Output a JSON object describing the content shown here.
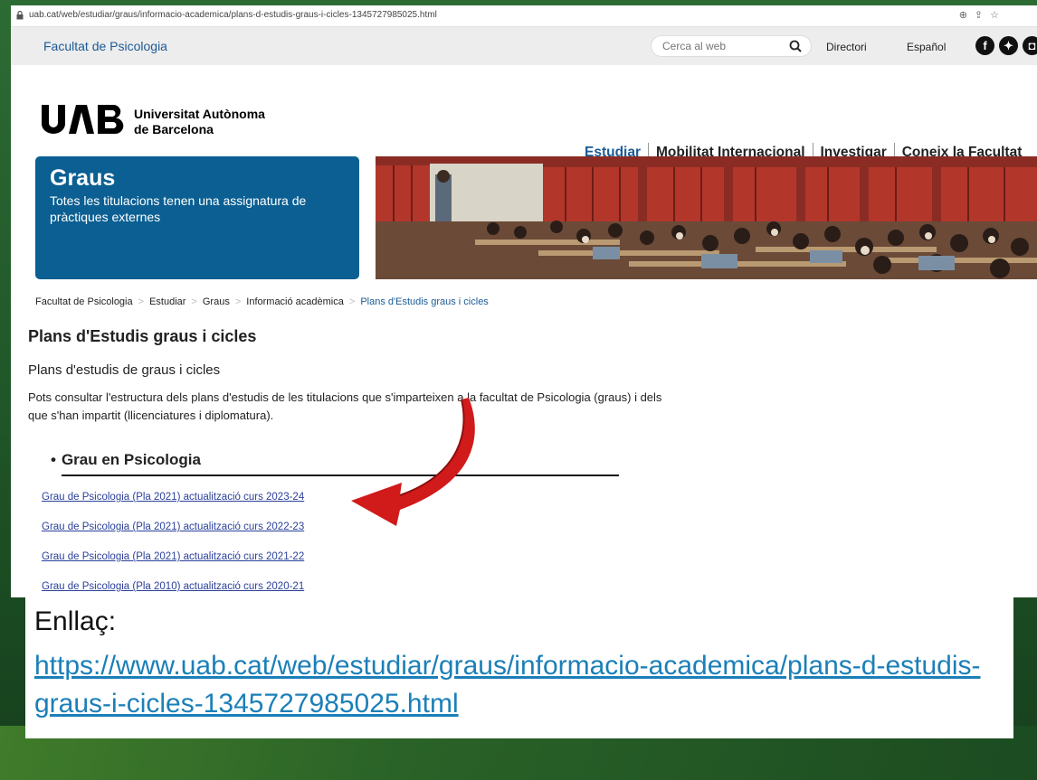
{
  "browser": {
    "url": "uab.cat/web/estudiar/graus/informacio-academica/plans-d-estudis-graus-i-cicles-1345727985025.html"
  },
  "topbar": {
    "faculty": "Facultat de Psicologia",
    "search_placeholder": "Cerca al web",
    "directory": "Directori",
    "language": "Español"
  },
  "logo": {
    "mark": "UAB",
    "name_line1": "Universitat Autònoma",
    "name_line2": "de Barcelona"
  },
  "nav": {
    "items": [
      "Estudiar",
      "Mobilitat Internacional",
      "Investigar",
      "Coneix la Facultat"
    ]
  },
  "hero": {
    "title": "Graus",
    "text": "Totes les titulacions tenen una assignatura de pràctiques externes"
  },
  "breadcrumb": {
    "items": [
      "Facultat de Psicologia",
      "Estudiar",
      "Graus",
      "Informació acadèmica",
      "Plans d'Estudis graus i cicles"
    ]
  },
  "page": {
    "title": "Plans d'Estudis graus i cicles",
    "subtitle": "Plans d'estudis de graus i cicles",
    "intro": "Pots consultar l'estructura dels plans d'estudis de les titulacions que s'imparteixen a la facultat de Psicologia (graus) i dels que s'han impartit (llicenciatures i diplomatura).",
    "section_title": "Grau en Psicologia",
    "bullet": "•",
    "links": [
      "Grau de Psicologia (Pla 2021) actualització curs 2023-24",
      "Grau de Psicologia (Pla 2021) actualització curs 2022-23",
      "Grau de Psicologia (Pla 2021) actualització curs 2021-22",
      "Grau de Psicologia (Pla 2010) actualització curs 2020-21"
    ]
  },
  "callout": {
    "label": "Enllaç:",
    "url": "https://www.uab.cat/web/estudiar/graus/informacio-academica/plans-d-estudis-graus-i-cicles-1345727985025.html"
  },
  "colors": {
    "uab_blue": "#0b5f92",
    "link_blue": "#1b7fb8",
    "arrow_red": "#d11a1a",
    "slide_green": "#1f5527"
  }
}
